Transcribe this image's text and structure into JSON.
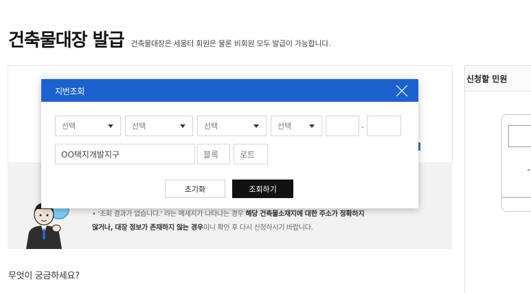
{
  "page": {
    "title": "건축물대장 발급",
    "subtitle": "건축물대장은 세움터 회원은 물론 비회원 모두 발급이 가능합니다."
  },
  "modal": {
    "title": "지번조회",
    "selects": [
      "선택",
      "선택",
      "선택",
      "선택"
    ],
    "dash": "-",
    "district_input": "OO택지개발지구",
    "block_placeholder": "블록",
    "lot_placeholder": "로트",
    "reset_label": "초기화",
    "search_label": "조회하기"
  },
  "notice": {
    "bullet": "•",
    "line1_prefix": "'조회 결과가 없습니다.' 라는 메세지가 나타나는 경우 ",
    "line1_bold": "해당 건축물소재지에 대한 주소가 정확하지",
    "line2_bold1": "않거나, 대장 정보가 존재하지 않는 경우",
    "line2_suffix": "이니 확인 후 다시 신청하시기 바랍니다."
  },
  "faq": {
    "heading": "무엇이 궁금하세요?"
  },
  "side": {
    "header": "신청할 민원"
  }
}
